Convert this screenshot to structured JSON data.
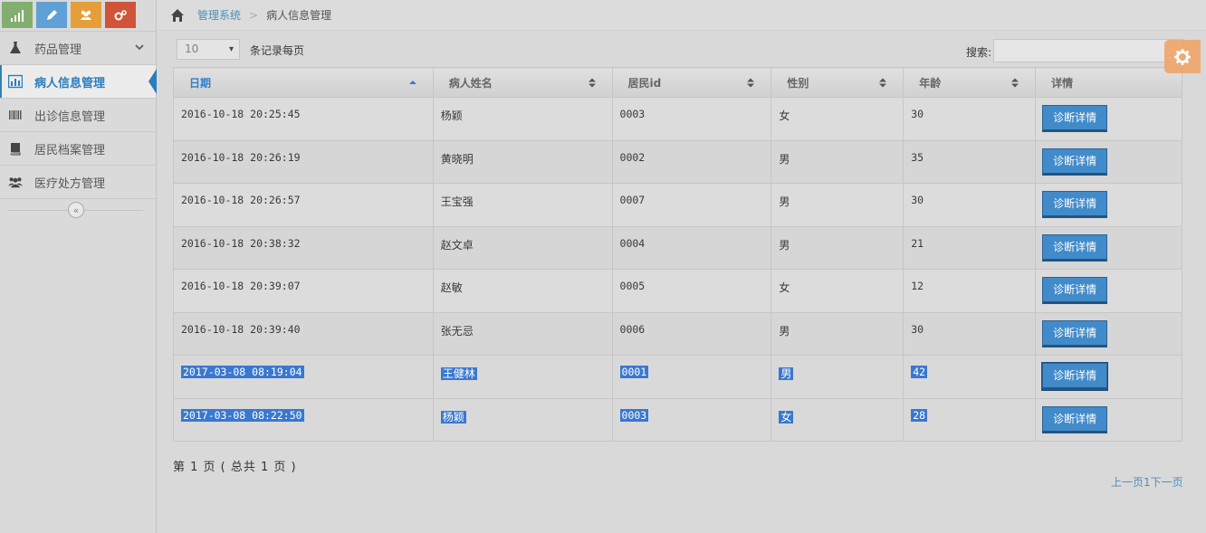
{
  "sidebar": {
    "items": [
      {
        "label": "药品管理"
      },
      {
        "label": "病人信息管理"
      },
      {
        "label": "出诊信息管理"
      },
      {
        "label": "居民档案管理"
      },
      {
        "label": "医疗处方管理"
      }
    ],
    "collapse_glyph": "«"
  },
  "breadcrumb": {
    "home_icon": "home-icon",
    "link": "管理系统",
    "sep": ">",
    "current": "病人信息管理"
  },
  "toolbar": {
    "page_length": "10",
    "caret": "▾",
    "length_suffix": "条记录每页",
    "search_label": "搜索:",
    "search_value": ""
  },
  "table": {
    "headers": [
      "日期",
      "病人姓名",
      "居民id",
      "性别",
      "年龄",
      "详情"
    ],
    "rows": [
      {
        "date": "2016-10-18 20:25:45",
        "name": "杨颖",
        "rid": "0003",
        "sex": "女",
        "age": "30",
        "btn": "诊断详情"
      },
      {
        "date": "2016-10-18 20:26:19",
        "name": "黄晓明",
        "rid": "0002",
        "sex": "男",
        "age": "35",
        "btn": "诊断详情"
      },
      {
        "date": "2016-10-18 20:26:57",
        "name": "王宝强",
        "rid": "0007",
        "sex": "男",
        "age": "30",
        "btn": "诊断详情"
      },
      {
        "date": "2016-10-18 20:38:32",
        "name": "赵文卓",
        "rid": "0004",
        "sex": "男",
        "age": "21",
        "btn": "诊断详情"
      },
      {
        "date": "2016-10-18 20:39:07",
        "name": "赵敏",
        "rid": "0005",
        "sex": "女",
        "age": "12",
        "btn": "诊断详情"
      },
      {
        "date": "2016-10-18 20:39:40",
        "name": "张无忌",
        "rid": "0006",
        "sex": "男",
        "age": "30",
        "btn": "诊断详情"
      },
      {
        "date": "2017-03-08 08:19:04",
        "name": "王健林",
        "rid": "0001",
        "sex": "男",
        "age": "42",
        "btn": "诊断详情"
      },
      {
        "date": "2017-03-08 08:22:50",
        "name": "杨颖",
        "rid": "0003",
        "sex": "女",
        "age": "28",
        "btn": "诊断详情"
      }
    ]
  },
  "footer": {
    "page_info": "第 1 页 ( 总共 1 页 )",
    "prev": "上一页",
    "page": "1",
    "next": "下一页"
  },
  "colors": {
    "accent": "#428bca",
    "active_nav": "#2b7dbc",
    "selection": "#3a78d0"
  }
}
